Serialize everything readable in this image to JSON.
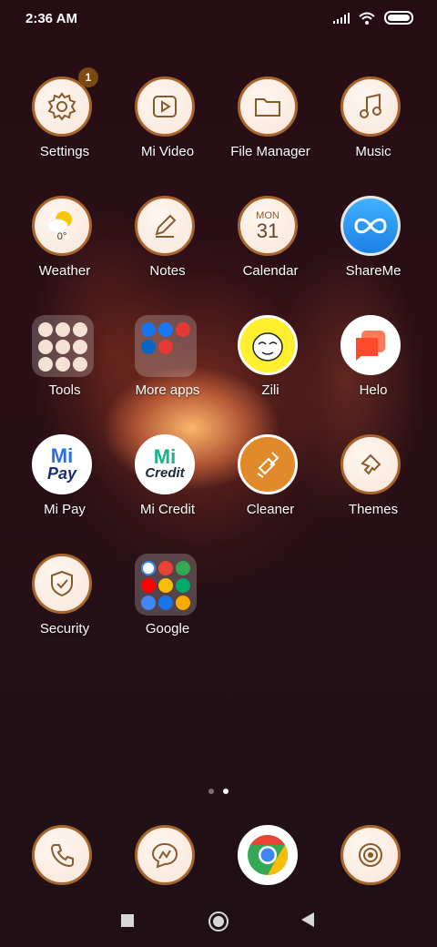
{
  "status_bar": {
    "time": "2:36 AM"
  },
  "apps": [
    {
      "label": "Settings",
      "badge": "1"
    },
    {
      "label": "Mi Video"
    },
    {
      "label": "File Manager"
    },
    {
      "label": "Music"
    },
    {
      "label": "Weather",
      "temp": "0°"
    },
    {
      "label": "Notes"
    },
    {
      "label": "Calendar",
      "day": "MON",
      "date": "31"
    },
    {
      "label": "ShareMe"
    },
    {
      "label": "Tools"
    },
    {
      "label": "More apps"
    },
    {
      "label": "Zili"
    },
    {
      "label": "Helo"
    },
    {
      "label": "Mi Pay",
      "icon_text": "Pay"
    },
    {
      "label": "Mi Credit",
      "icon_text": "Credit"
    },
    {
      "label": "Cleaner"
    },
    {
      "label": "Themes"
    },
    {
      "label": "Security"
    },
    {
      "label": "Google"
    }
  ],
  "icon_brand": {
    "mi": "Mi"
  },
  "pager": {
    "pages": 2,
    "active": 2
  },
  "colors": {
    "icon_ring": "#a8652c",
    "accent_brown": "#7a4a10"
  }
}
